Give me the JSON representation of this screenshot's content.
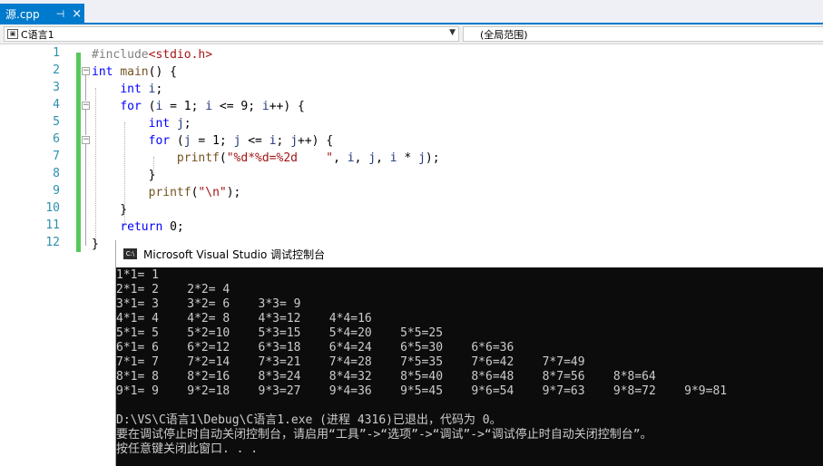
{
  "tab": {
    "title": "源.cpp",
    "pin_icon": "pin-icon",
    "close_icon": "close-icon",
    "close_glyph": "×",
    "pin_glyph": "⊣"
  },
  "navbar": {
    "project": "C语言1",
    "scope": "(全局范围)"
  },
  "editor": {
    "line_numbers": [
      "1",
      "2",
      "3",
      "4",
      "5",
      "6",
      "7",
      "8",
      "9",
      "10",
      "11",
      "12"
    ],
    "lines": [
      [
        {
          "c": "pp",
          "t": "#include"
        },
        {
          "c": "str",
          "t": "<stdio.h>"
        }
      ],
      [
        {
          "c": "kw",
          "t": "int"
        },
        {
          "c": "",
          "t": " "
        },
        {
          "c": "fn",
          "t": "main"
        },
        {
          "c": "",
          "t": "() {"
        }
      ],
      [
        {
          "c": "",
          "t": "    "
        },
        {
          "c": "kw",
          "t": "int"
        },
        {
          "c": "",
          "t": " "
        },
        {
          "c": "var",
          "t": "i"
        },
        {
          "c": "",
          "t": ";"
        }
      ],
      [
        {
          "c": "",
          "t": "    "
        },
        {
          "c": "kw",
          "t": "for"
        },
        {
          "c": "",
          "t": " ("
        },
        {
          "c": "var",
          "t": "i"
        },
        {
          "c": "",
          "t": " = 1; "
        },
        {
          "c": "var",
          "t": "i"
        },
        {
          "c": "",
          "t": " <= 9; "
        },
        {
          "c": "var",
          "t": "i"
        },
        {
          "c": "",
          "t": "++) {"
        }
      ],
      [
        {
          "c": "",
          "t": "        "
        },
        {
          "c": "kw",
          "t": "int"
        },
        {
          "c": "",
          "t": " "
        },
        {
          "c": "var",
          "t": "j"
        },
        {
          "c": "",
          "t": ";"
        }
      ],
      [
        {
          "c": "",
          "t": "        "
        },
        {
          "c": "kw",
          "t": "for"
        },
        {
          "c": "",
          "t": " ("
        },
        {
          "c": "var",
          "t": "j"
        },
        {
          "c": "",
          "t": " = 1; "
        },
        {
          "c": "var",
          "t": "j"
        },
        {
          "c": "",
          "t": " <= "
        },
        {
          "c": "var",
          "t": "i"
        },
        {
          "c": "",
          "t": "; "
        },
        {
          "c": "var",
          "t": "j"
        },
        {
          "c": "",
          "t": "++) {"
        }
      ],
      [
        {
          "c": "",
          "t": "            "
        },
        {
          "c": "fn",
          "t": "printf"
        },
        {
          "c": "",
          "t": "("
        },
        {
          "c": "str",
          "t": "\"%d*%d=%2d    \""
        },
        {
          "c": "",
          "t": ", "
        },
        {
          "c": "var",
          "t": "i"
        },
        {
          "c": "",
          "t": ", "
        },
        {
          "c": "var",
          "t": "j"
        },
        {
          "c": "",
          "t": ", "
        },
        {
          "c": "var",
          "t": "i"
        },
        {
          "c": "",
          "t": " * "
        },
        {
          "c": "var",
          "t": "j"
        },
        {
          "c": "",
          "t": ");"
        }
      ],
      [
        {
          "c": "",
          "t": "        }"
        }
      ],
      [
        {
          "c": "",
          "t": "        "
        },
        {
          "c": "fn",
          "t": "printf"
        },
        {
          "c": "",
          "t": "("
        },
        {
          "c": "str",
          "t": "\"\\n\""
        },
        {
          "c": "",
          "t": ");"
        }
      ],
      [
        {
          "c": "",
          "t": "    }"
        }
      ],
      [
        {
          "c": "",
          "t": "    "
        },
        {
          "c": "kw",
          "t": "return"
        },
        {
          "c": "",
          "t": " 0;"
        }
      ],
      [
        {
          "c": "",
          "t": "}"
        }
      ]
    ]
  },
  "console": {
    "title": "Microsoft Visual Studio 调试控制台",
    "lines": [
      "1*1= 1",
      "2*1= 2    2*2= 4",
      "3*1= 3    3*2= 6    3*3= 9",
      "4*1= 4    4*2= 8    4*3=12    4*4=16",
      "5*1= 5    5*2=10    5*3=15    5*4=20    5*5=25",
      "6*1= 6    6*2=12    6*3=18    6*4=24    6*5=30    6*6=36",
      "7*1= 7    7*2=14    7*3=21    7*4=28    7*5=35    7*6=42    7*7=49",
      "8*1= 8    8*2=16    8*3=24    8*4=32    8*5=40    8*6=48    8*7=56    8*8=64",
      "9*1= 9    9*2=18    9*3=27    9*4=36    9*5=45    9*6=54    9*7=63    9*8=72    9*9=81",
      "",
      "D:\\VS\\C语言1\\Debug\\C语言1.exe (进程 4316)已退出，代码为 0。",
      "要在调试停止时自动关闭控制台，请启用“工具”->“选项”->“调试”->“调试停止时自动关闭控制台”。",
      "按任意键关闭此窗口. . ."
    ]
  }
}
